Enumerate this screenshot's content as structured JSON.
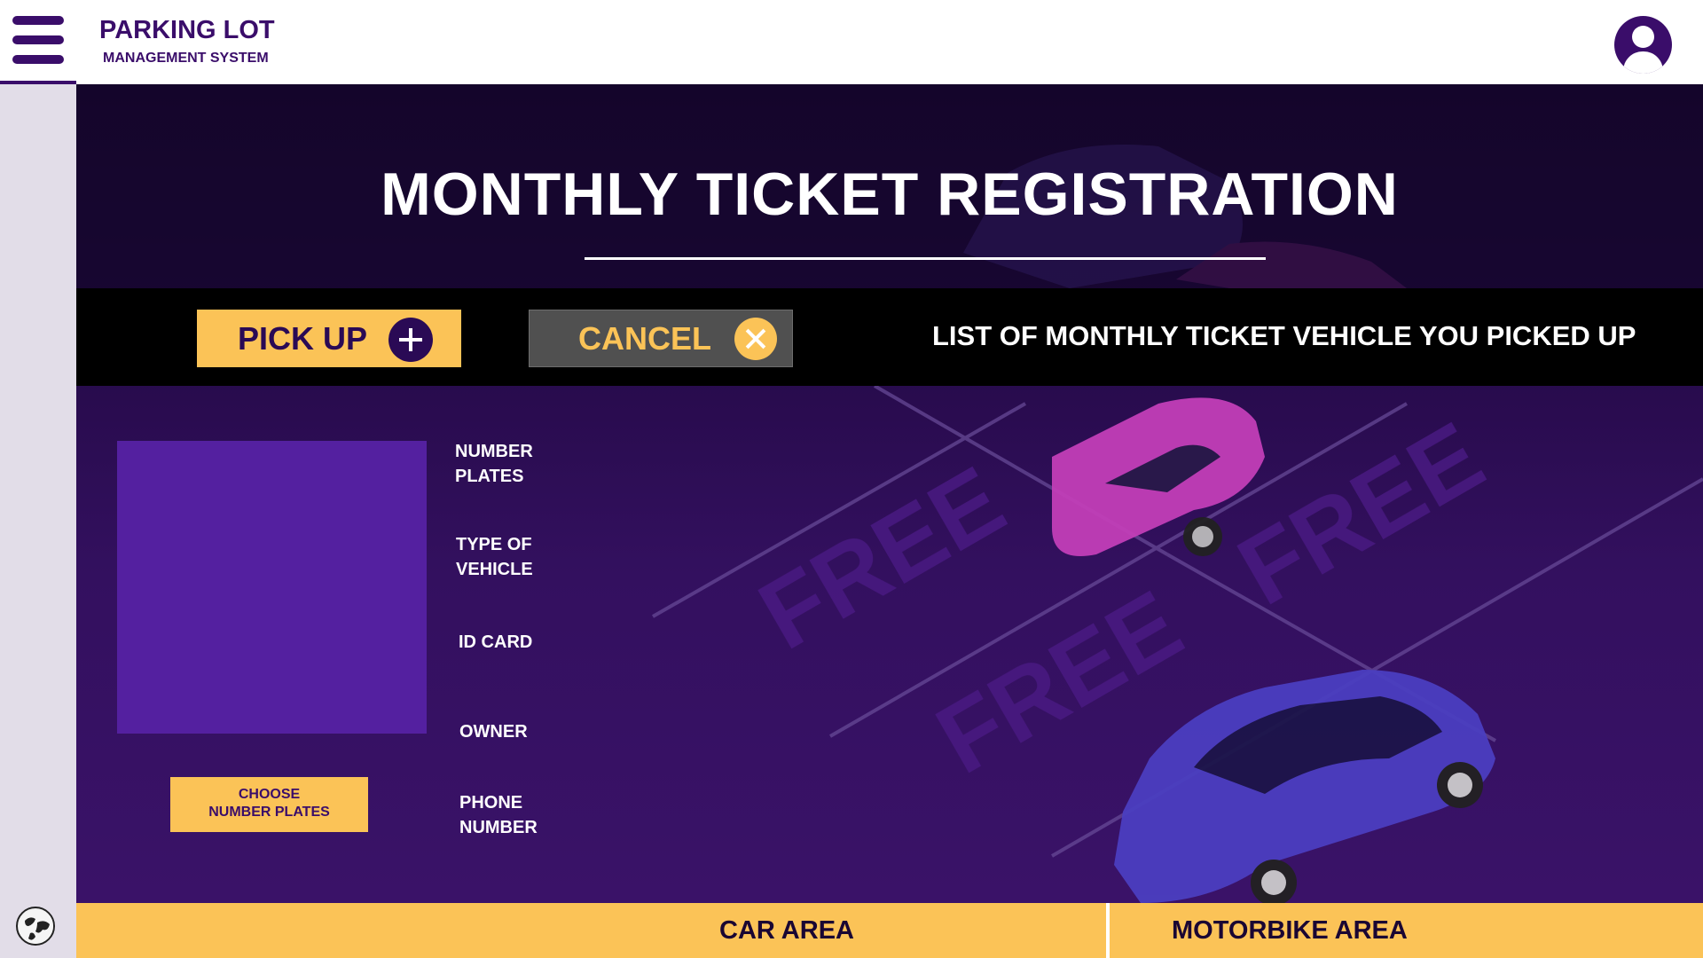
{
  "app": {
    "title": "PARKING LOT",
    "subtitle": "MANAGEMENT SYSTEM"
  },
  "page": {
    "title": "MONTHLY TICKET REGISTRATION"
  },
  "actions": {
    "pickup_label": "PICK UP",
    "cancel_label": "CANCEL",
    "list_heading": "LIST OF MONTHLY TICKET VEHICLE YOU PICKED UP"
  },
  "form": {
    "choose_line1": "CHOOSE",
    "choose_line2": "NUMBER PLATES",
    "fields": [
      "NUMBER PLATES",
      "TYPE OF VEHICLE",
      "ID CARD",
      "OWNER",
      "PHONE NUMBER"
    ]
  },
  "background": {
    "lot_marks": [
      "FREE",
      "FREE",
      "FREE"
    ]
  },
  "tabs": {
    "car_label": "CAR AREA",
    "motorbike_label": "MOTORBIKE AREA"
  },
  "colors": {
    "brand_purple": "#3a0d6a",
    "accent_yellow": "#fbc357",
    "sidebar_gray": "#e2dde8",
    "photo_purple": "#5420a0"
  },
  "icons": [
    "menu-icon",
    "user-avatar-icon",
    "plus-icon",
    "close-icon",
    "globe-icon"
  ]
}
